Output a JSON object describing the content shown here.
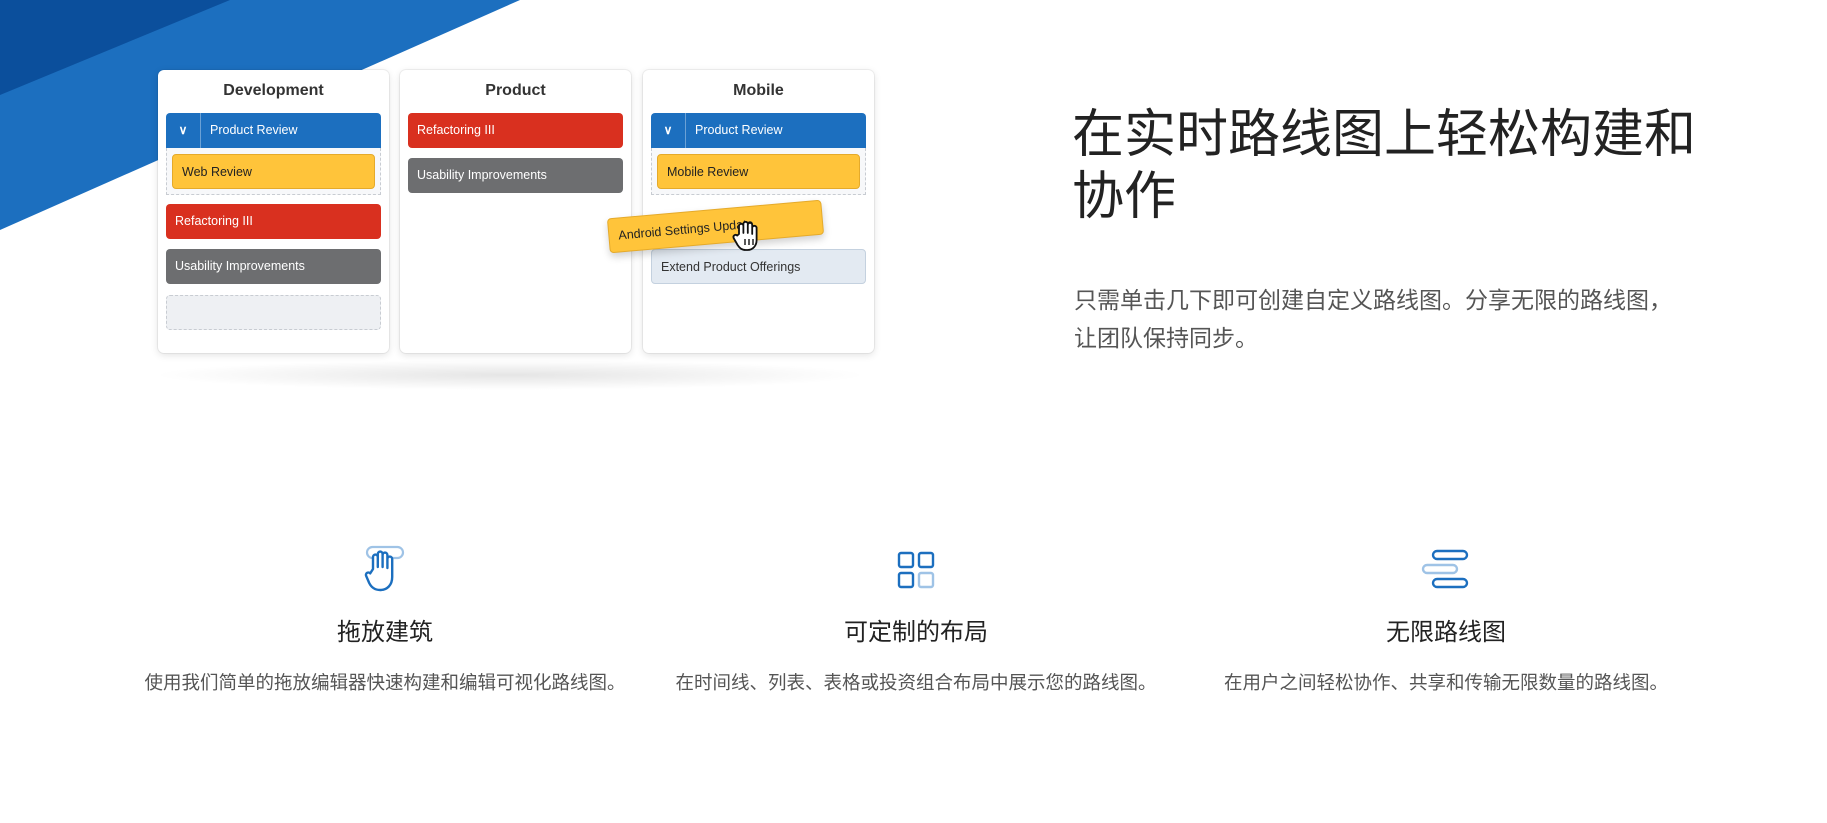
{
  "colors": {
    "brand_blue": "#1c6fbf",
    "dark_blue": "#0b4f9c",
    "red": "#d9301f",
    "gray": "#6d6e70",
    "yellow": "#ffc43a"
  },
  "board": {
    "columns": [
      {
        "title": "Development",
        "group": {
          "label": "Product Review",
          "child": "Web Review"
        },
        "cards": [
          "Refactoring III",
          "Usability Improvements"
        ]
      },
      {
        "title": "Product",
        "cards": [
          "Refactoring III",
          "Usability Improvements"
        ]
      },
      {
        "title": "Mobile",
        "group": {
          "label": "Product Review",
          "child": "Mobile Review"
        },
        "cards": [
          "Extend Product Offerings"
        ]
      }
    ],
    "dragging_card": "Android Settings Update"
  },
  "hero": {
    "title": "在实时路线图上轻松构建和协作",
    "description": "只需单击几下即可创建自定义路线图。分享无限的路线图，让团队保持同步。"
  },
  "features": [
    {
      "icon": "drag-hand-icon",
      "title": "拖放建筑",
      "description": "使用我们简单的拖放编辑器快速构建和编辑可视化路线图。"
    },
    {
      "icon": "grid-layout-icon",
      "title": "可定制的布局",
      "description": "在时间线、列表、表格或投资组合布局中展示您的路线图。"
    },
    {
      "icon": "timeline-bars-icon",
      "title": "无限路线图",
      "description": "在用户之间轻松协作、共享和传输无限数量的路线图。"
    }
  ]
}
